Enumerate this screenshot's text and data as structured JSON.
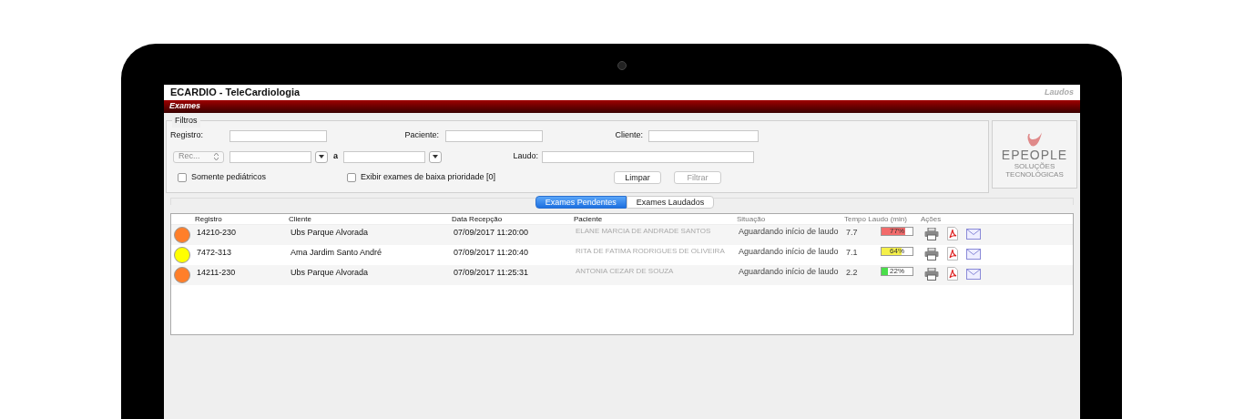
{
  "window": {
    "title": "ECARDIO - TeleCardiologia",
    "section": "Laudos"
  },
  "menu_bar": {
    "label": "Exames"
  },
  "filters": {
    "legend": "Filtros",
    "registro": {
      "label": "Registro:"
    },
    "paciente": {
      "label": "Paciente:"
    },
    "cliente": {
      "label": "Cliente:"
    },
    "date_type": {
      "value": "Rec..."
    },
    "date_range_separator": "a",
    "laudo": {
      "label": "Laudo:"
    },
    "checkboxes": [
      {
        "label": "Somente pediátricos",
        "checked": false
      },
      {
        "label": "Exibir exames de baixa prioridade [0]",
        "checked": false
      }
    ],
    "buttons": [
      {
        "label": "Limpar",
        "disabled": false
      },
      {
        "label": "Filtrar",
        "disabled": true
      }
    ]
  },
  "logo": {
    "name": "EPEOPLE",
    "tagline": "SOLUÇÕES TECNOLÓGICAS"
  },
  "tabs": [
    {
      "label": "Exames Pendentes",
      "selected": true
    },
    {
      "label": "Exames Laudados",
      "selected": false
    }
  ],
  "table": {
    "columns": [
      "Registro",
      "Cliente",
      "Data Recepção",
      "Paciente",
      "Situação",
      "Tempo Laudo (min)",
      "Ações"
    ],
    "rows": [
      {
        "color": "#ff7f2a",
        "registro": "14210-230",
        "cliente": "Ubs Parque Alvorada",
        "data": "07/09/2017 11:20:00",
        "paciente": "ELANE MARCIA DE ANDRADE SANTOS",
        "situacao": "Aguardando início de laudo",
        "tempo": "7.7",
        "bar": {
          "level": 0.77,
          "label": "77%",
          "color": "#f26b6b"
        }
      },
      {
        "color": "#ffff00",
        "registro": "7472-313",
        "cliente": "Ama Jardim Santo André",
        "data": "07/09/2017 11:20:40",
        "paciente": "RITA DE FATIMA RODRIGUES DE OLIVEIRA",
        "situacao": "Aguardando início de laudo",
        "tempo": "7.1",
        "bar": {
          "level": 0.64,
          "label": "64%",
          "color": "#f5f04a"
        }
      },
      {
        "color": "#ff7f2a",
        "registro": "14211-230",
        "cliente": "Ubs Parque Alvorada",
        "data": "07/09/2017 11:25:31",
        "paciente": "ANTONIA CEZAR DE SOUZA",
        "situacao": "Aguardando início de laudo",
        "tempo": "2.2",
        "bar": {
          "level": 0.22,
          "label": "22%",
          "color": "#4ade4a"
        }
      }
    ]
  }
}
